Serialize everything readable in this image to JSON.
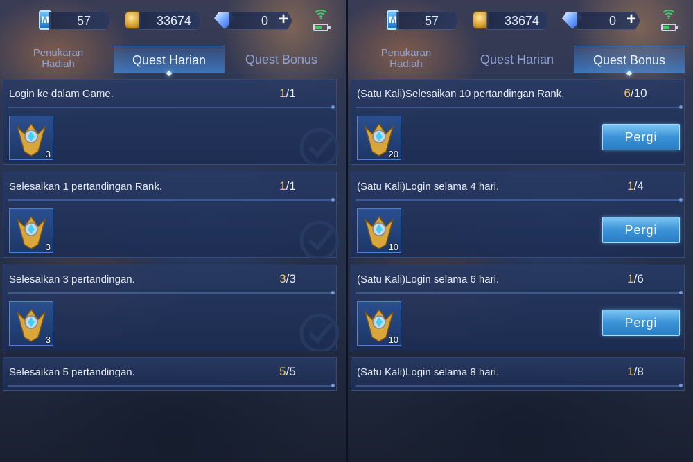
{
  "left": {
    "currency": {
      "medals": "57",
      "coins": "33674",
      "diamonds": "0"
    },
    "tabs": [
      {
        "label_line1": "Penukaran",
        "label_line2": "Hadiah",
        "active": false
      },
      {
        "label": "Quest Harian",
        "active": true
      },
      {
        "label": "Quest Bonus",
        "active": false
      }
    ],
    "quests": [
      {
        "title": "Login ke dalam Game.",
        "done": "1",
        "total": "/1",
        "reward": "3",
        "completed": true
      },
      {
        "title": "Selesaikan 1 pertandingan Rank.",
        "done": "1",
        "total": "/1",
        "reward": "3",
        "completed": true
      },
      {
        "title": "Selesaikan 3 pertandingan.",
        "done": "3",
        "total": "/3",
        "reward": "3",
        "completed": true
      },
      {
        "title": "Selesaikan 5 pertandingan.",
        "done": "5",
        "total": "/5"
      }
    ]
  },
  "right": {
    "currency": {
      "medals": "57",
      "coins": "33674",
      "diamonds": "0"
    },
    "tabs": [
      {
        "label_line1": "Penukaran",
        "label_line2": "Hadiah",
        "active": false
      },
      {
        "label": "Quest Harian",
        "active": false
      },
      {
        "label": "Quest Bonus",
        "active": true
      }
    ],
    "quests": [
      {
        "title": "(Satu Kali)Selesaikan 10 pertandingan Rank.",
        "done": "6",
        "total": "/10",
        "reward": "20",
        "button": "Pergi"
      },
      {
        "title": "(Satu Kali)Login selama 4 hari.",
        "done": "1",
        "total": "/4",
        "reward": "10",
        "button": "Pergi"
      },
      {
        "title": "(Satu Kali)Login selama 6 hari.",
        "done": "1",
        "total": "/6",
        "reward": "10",
        "button": "Pergi"
      },
      {
        "title": "(Satu Kali)Login selama 8 hari.",
        "done": "1",
        "total": "/8"
      }
    ]
  },
  "colors": {
    "accent": "#3b92d6",
    "progress_done": "#f2c86a",
    "tab_inactive": "#8fa4d4"
  },
  "icons": [
    "medal-icon",
    "coin-icon",
    "diamond-icon",
    "plus-icon",
    "wifi-icon",
    "battery-icon",
    "check-circle-icon",
    "emblem-icon"
  ]
}
